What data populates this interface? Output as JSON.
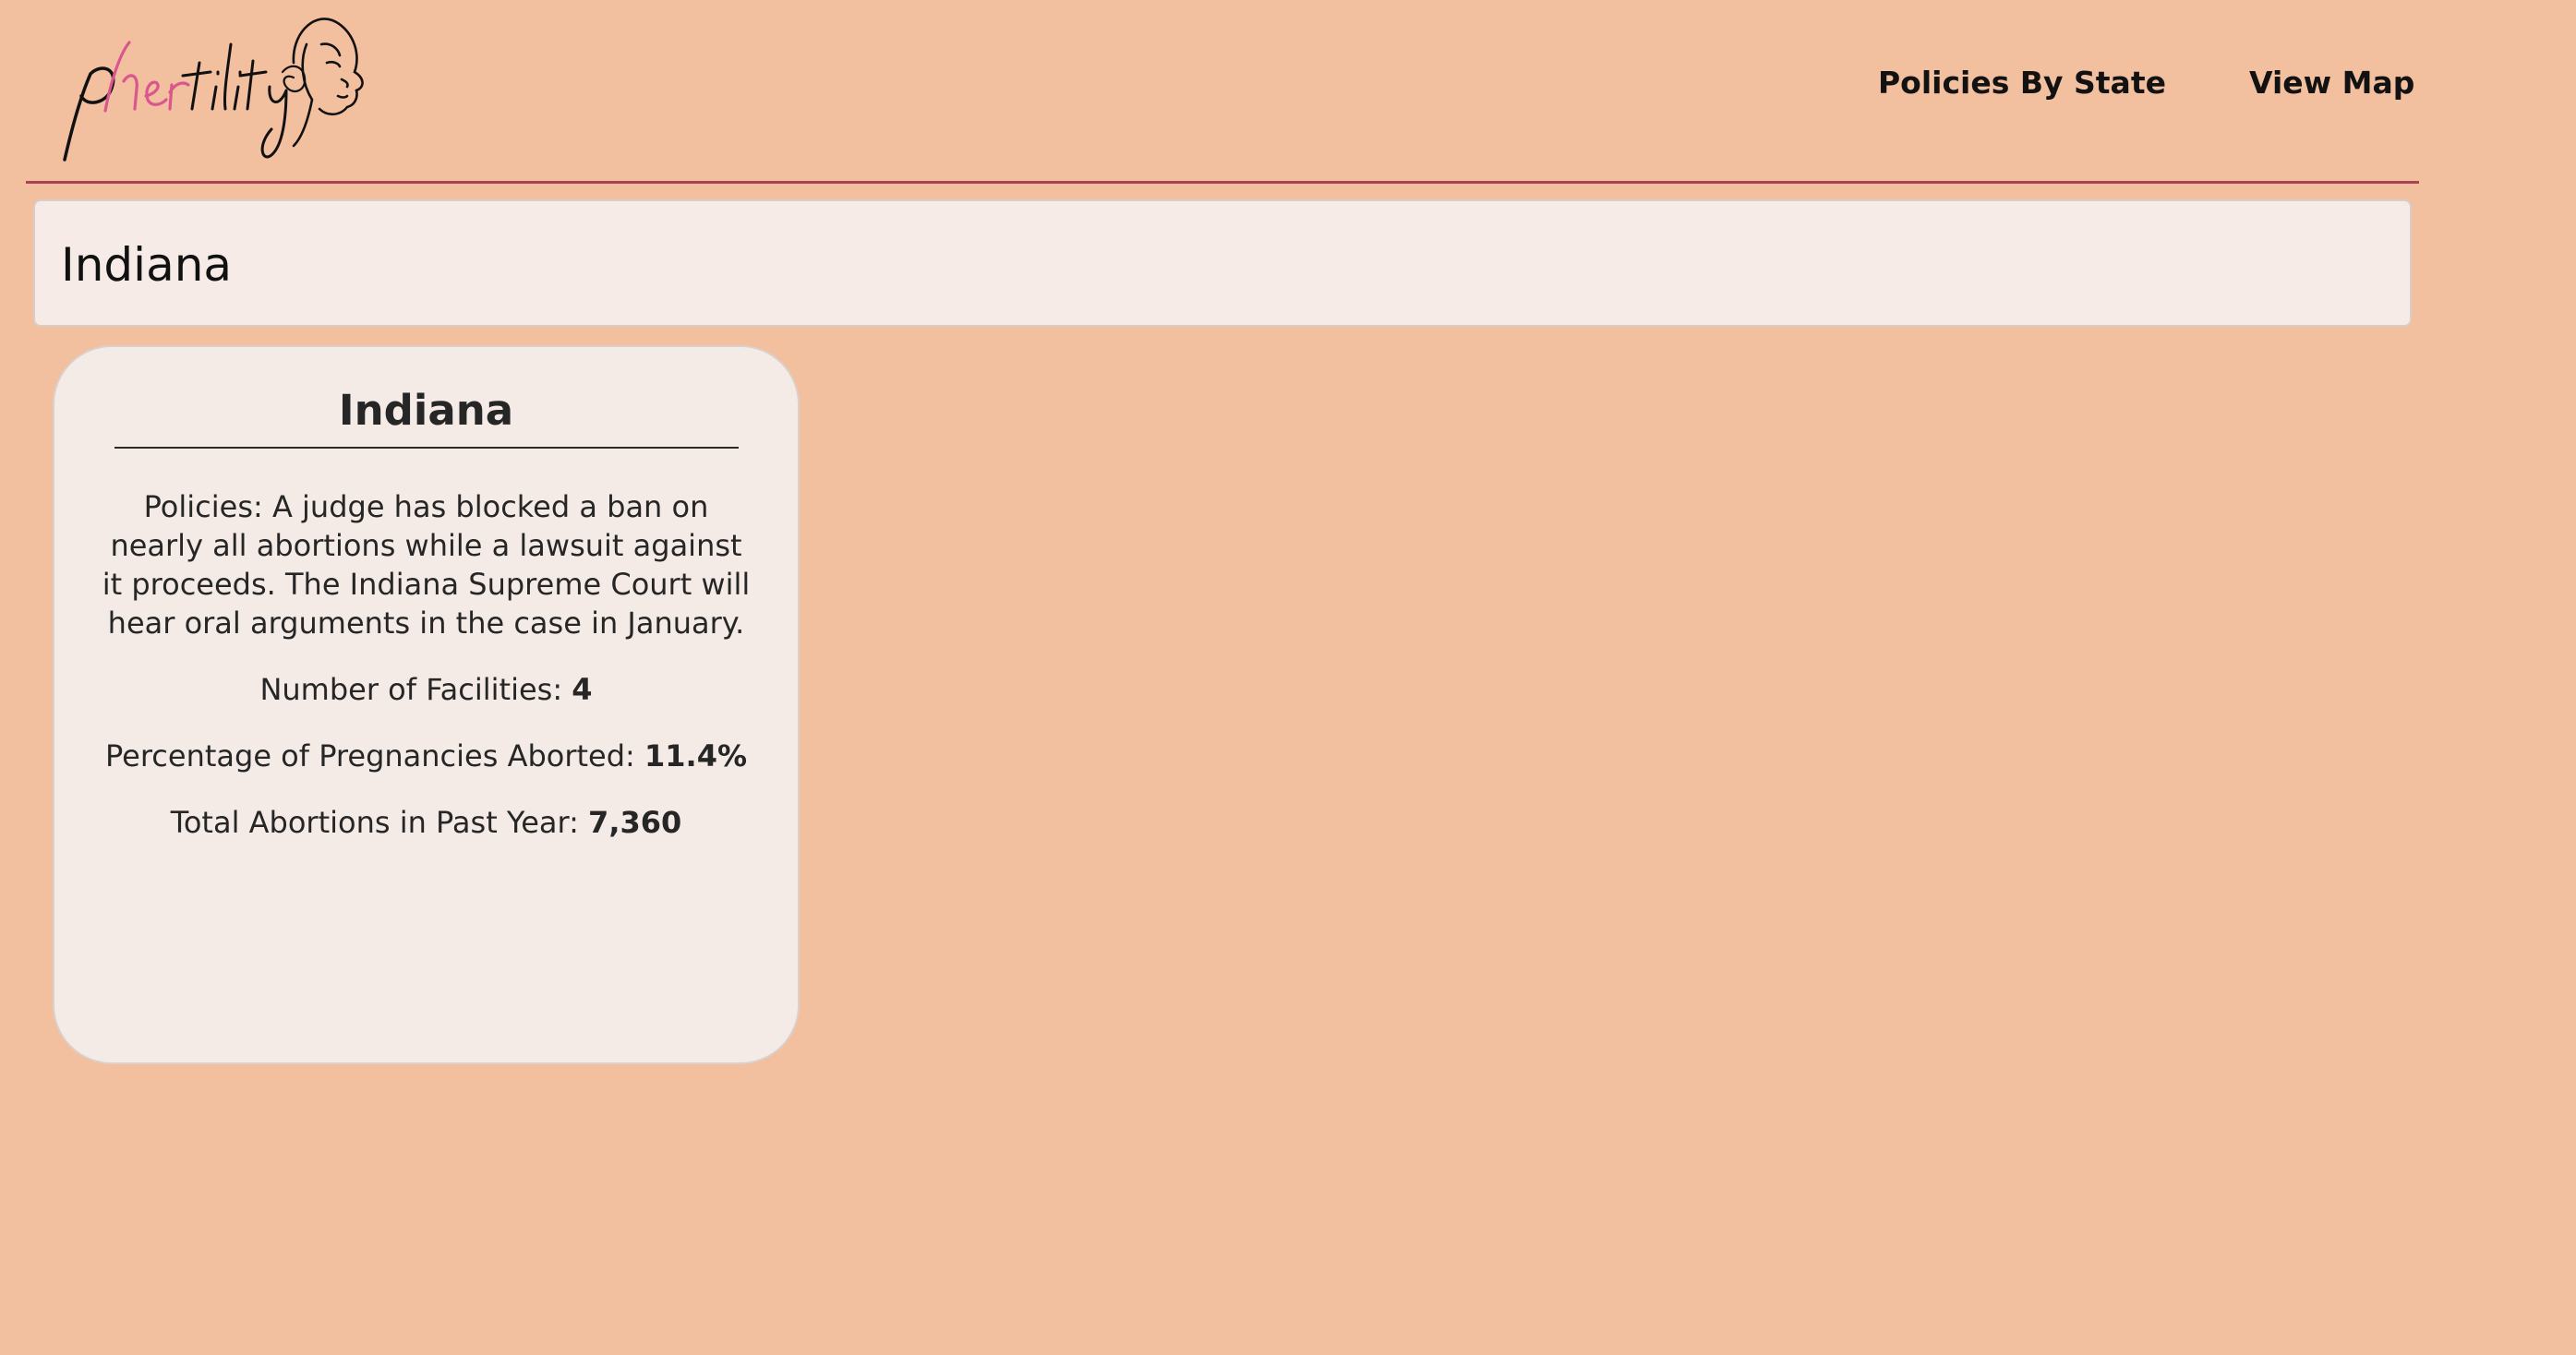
{
  "header": {
    "logo_text": "phertility",
    "nav": [
      {
        "label": "Policies By State"
      },
      {
        "label": "View Map"
      }
    ]
  },
  "search": {
    "value": "Indiana"
  },
  "state_card": {
    "title": "Indiana",
    "policies_label": "Policies:",
    "policies_text": "A judge has blocked a ban on nearly all abortions while a lawsuit against it proceeds. The Indiana Supreme Court will hear oral arguments in the case in January.",
    "facilities_label": "Number of Facilities:",
    "facilities_value": "4",
    "percent_label": "Percentage of Pregnancies Aborted:",
    "percent_value": "11.4%",
    "total_label": "Total Abortions in Past Year:",
    "total_value": "7,360"
  },
  "colors": {
    "background": "#f2bf9f",
    "divider": "#a94254",
    "logo_accent": "#d9568f",
    "card_background": "#f5ebe6"
  }
}
